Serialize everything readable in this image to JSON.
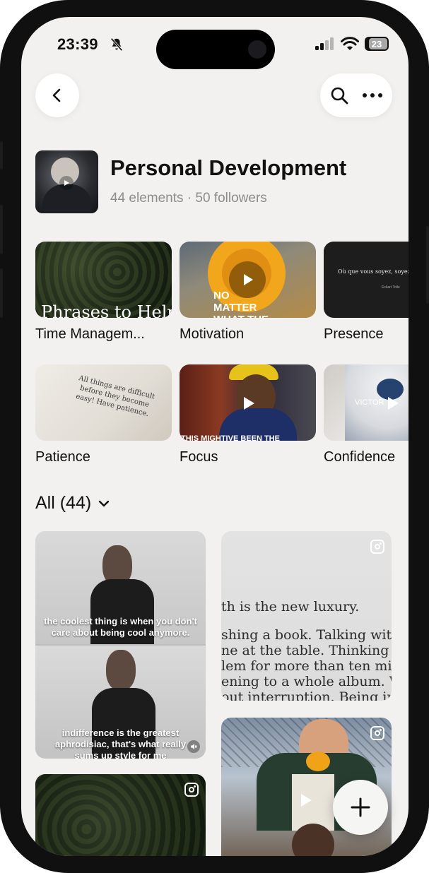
{
  "status_bar": {
    "time": "23:39",
    "battery": "23"
  },
  "header": {
    "title": "Personal Development",
    "subtitle": "44 elements · 50 followers"
  },
  "collections": [
    {
      "label": "Time Managem...",
      "thumb_text": "Phrases to Help"
    },
    {
      "label": "Motivation",
      "thumb_text": "NO MATTER WHAT THE WORLD"
    },
    {
      "label": "Presence",
      "thumb_text": "Où que vous soyez, soyez",
      "thumb_sub": "Eckart Tolle"
    },
    {
      "label": "Patience",
      "thumb_text": "All things are difficult before they become easy! Have patience."
    },
    {
      "label": "Focus",
      "thumb_text": "THIS MIGHTIVE BEEN THE"
    },
    {
      "label": "Confidence",
      "thumb_text": "VICTOR"
    }
  ],
  "section": {
    "title": "All (44)"
  },
  "feed": {
    "card1": {
      "caption_top": "the coolest thing is when you don't care about being cool anymore.",
      "caption_bottom": "indifference is the greatest aphrodisiac, that's what really sums up style for me"
    },
    "card2": {
      "lines": [
        "th is the new luxury.",
        "shing a book. Talking without",
        "ne at the table. Thinking abo",
        "lem for more than ten minu",
        "ening to a whole album. Writ",
        "out interruption. Being in a"
      ]
    }
  },
  "colors": {
    "background": "#f2f1ef",
    "text": "#111111",
    "muted": "#8c8c8c"
  },
  "icons": [
    "back-arrow-icon",
    "search-icon",
    "more-icon",
    "bell-muted-icon",
    "signal-icon",
    "wifi-icon",
    "battery-icon",
    "play-icon",
    "instagram-icon",
    "mute-icon",
    "chevron-down-icon",
    "plus-icon"
  ]
}
